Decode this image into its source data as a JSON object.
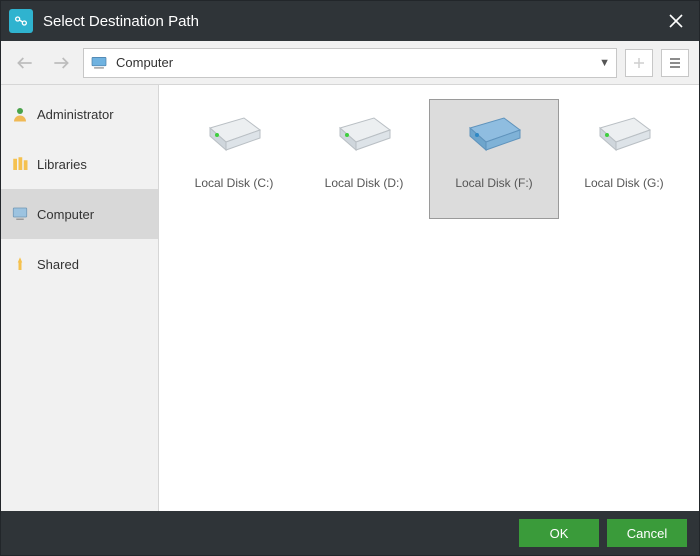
{
  "titlebar": {
    "title": "Select Destination Path"
  },
  "toolbar": {
    "path_label": "Computer"
  },
  "sidebar": {
    "items": [
      {
        "label": "Administrator"
      },
      {
        "label": "Libraries"
      },
      {
        "label": "Computer"
      },
      {
        "label": "Shared"
      }
    ],
    "selected_index": 2
  },
  "drives": {
    "items": [
      {
        "label": "Local Disk (C:)"
      },
      {
        "label": "Local Disk (D:)"
      },
      {
        "label": "Local Disk (F:)"
      },
      {
        "label": "Local Disk (G:)"
      }
    ],
    "selected_index": 2
  },
  "footer": {
    "ok_label": "OK",
    "cancel_label": "Cancel"
  }
}
